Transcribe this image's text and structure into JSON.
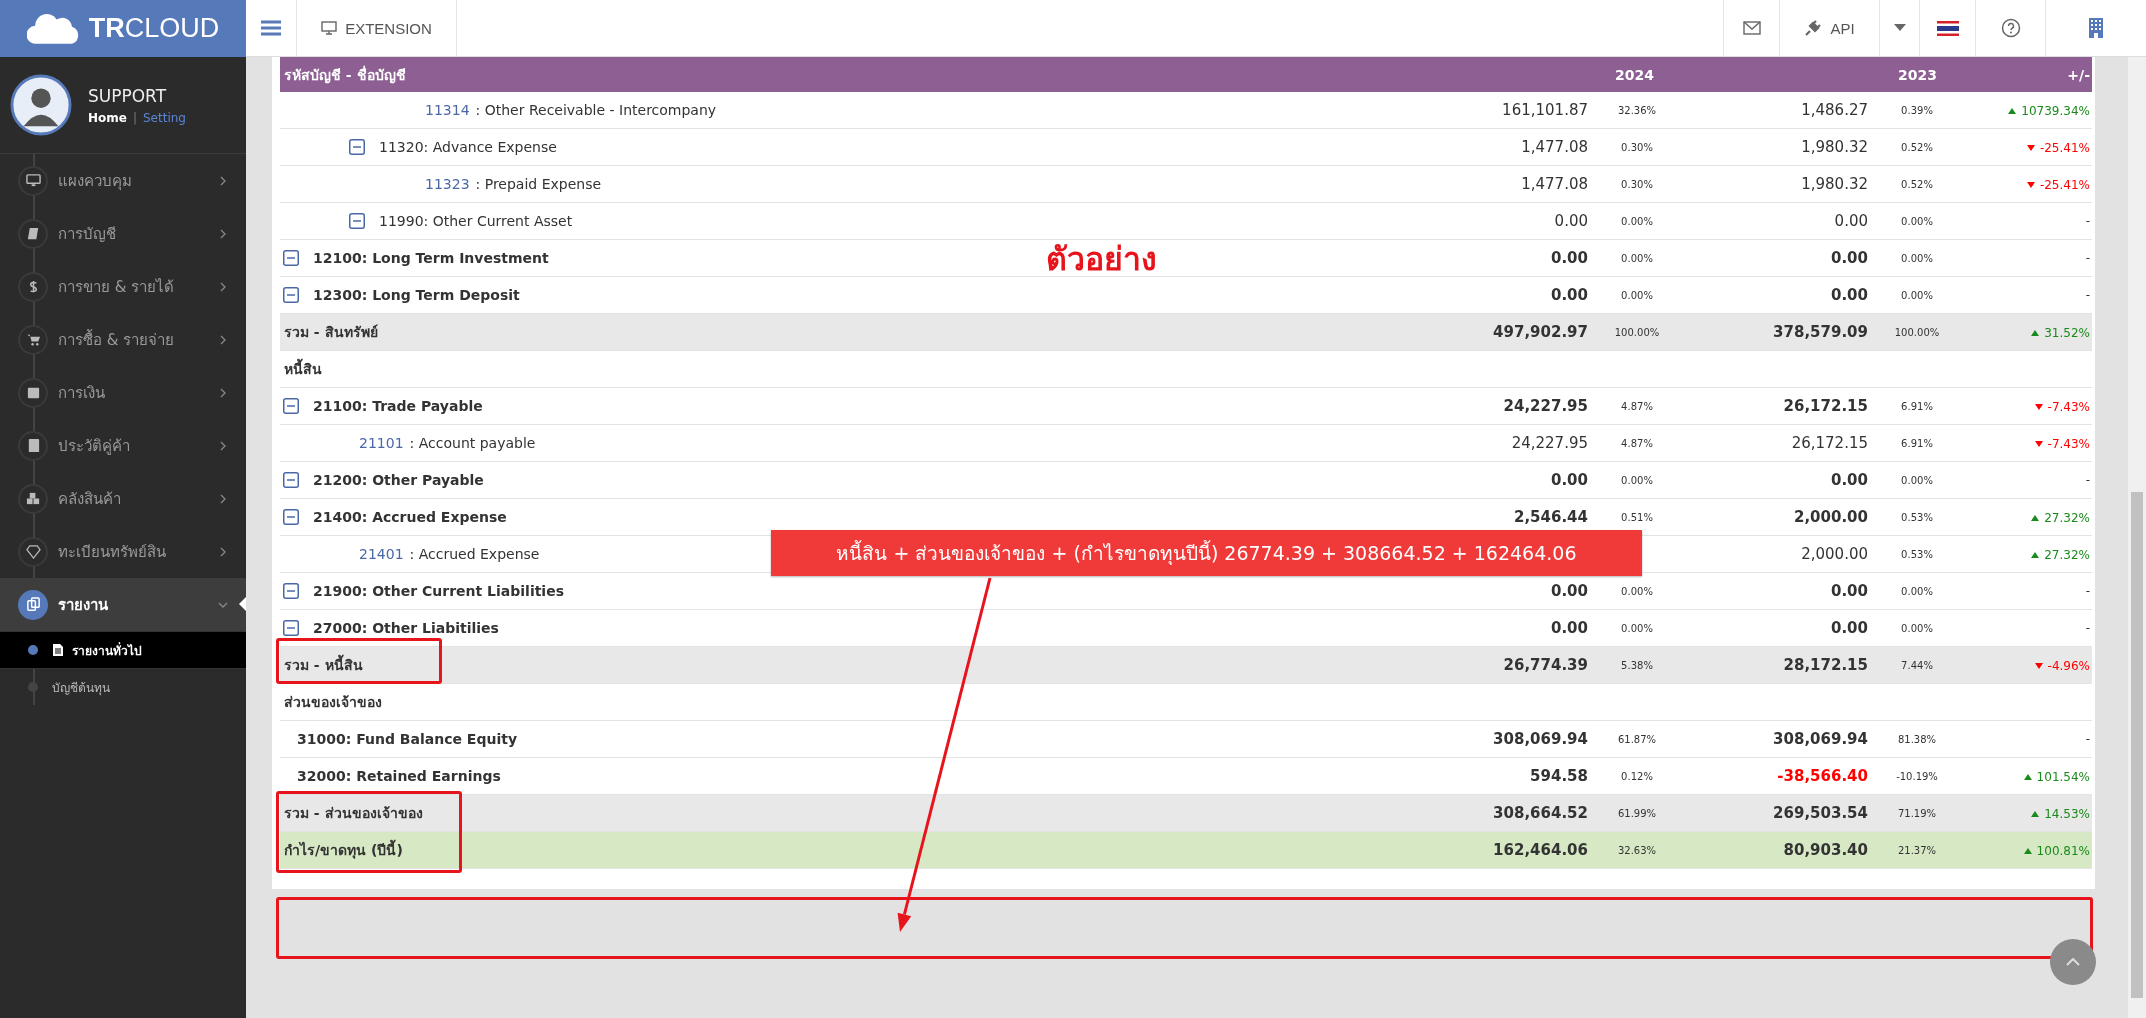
{
  "sidebar": {
    "logo": "**TR**CLOUD",
    "user": {
      "name": "SUPPORT",
      "separator": "|",
      "links": [
        {
          "label": "Home",
          "selected": true
        },
        {
          "label": "Setting",
          "selected": false
        }
      ]
    },
    "menu": [
      {
        "label": "แผงควบคุม",
        "selected": false,
        "expanded": false
      },
      {
        "label": "การบัญชี",
        "selected": false,
        "expanded": false
      },
      {
        "label": "การขาย & รายได้",
        "selected": false,
        "expanded": false
      },
      {
        "label": "การซื้อ & รายจ่าย",
        "selected": false,
        "expanded": false
      },
      {
        "label": "การเงิน",
        "selected": false,
        "expanded": false
      },
      {
        "label": "ประวัติคู่ค้า",
        "selected": false,
        "expanded": false
      },
      {
        "label": "คลังสินค้า",
        "selected": false,
        "expanded": false
      },
      {
        "label": "ทะเบียนทรัพย์สิน",
        "selected": false,
        "expanded": false
      },
      {
        "label": "รายงาน",
        "selected": true,
        "expanded": true,
        "children": [
          {
            "label": "รายงานทั่วไป",
            "selected": true
          },
          {
            "label": "บัญชีต้นทุน",
            "selected": false
          }
        ]
      }
    ]
  },
  "topbar": {
    "extension": "EXTENSION",
    "api": "API"
  },
  "table": {
    "columns": [
      "รหัสบัญชี - ชื่อบัญชี",
      "2024",
      "2023",
      "+/-"
    ],
    "rows": [
      {
        "kind": "continued",
        "children": [
          {
            "kind": "continued",
            "children": [
              {
                "kind": "account",
                "code": "11314",
                "separator": ":",
                "name": "Other Receivable - Intercompany",
                "a24": "161,101.87",
                "p24": "32.36%",
                "a23": "1,486.27",
                "p23": "0.39%",
                "change": "10739.34%",
                "up": true
              }
            ]
          },
          {
            "kind": "group",
            "label": "11320: Advance Expense",
            "a24": "1,477.08",
            "p24": "0.30%",
            "a23": "1,980.32",
            "p23": "0.52%",
            "change": "-25.41%",
            "up": false,
            "children": [
              {
                "kind": "account",
                "code": "11323",
                "separator": ":",
                "name": "Prepaid Expense",
                "a24": "1,477.08",
                "p24": "0.30%",
                "a23": "1,980.32",
                "p23": "0.52%",
                "change": "-25.41%",
                "up": false
              }
            ]
          },
          {
            "kind": "group",
            "label": "11990: Other Current Asset",
            "a24": "0.00",
            "p24": "0.00%",
            "a23": "0.00",
            "p23": "0.00%",
            "change": "-"
          }
        ]
      },
      {
        "kind": "group",
        "label": "12100: Long Term Investment",
        "a24": "0.00",
        "p24": "0.00%",
        "a23": "0.00",
        "p23": "0.00%",
        "change": "-"
      },
      {
        "kind": "group",
        "label": "12300: Long Term Deposit",
        "a24": "0.00",
        "p24": "0.00%",
        "a23": "0.00",
        "p23": "0.00%",
        "change": "-"
      },
      {
        "kind": "total",
        "label": "รวม - สินทรัพย์",
        "a24": "497,902.97",
        "p24": "100.00%",
        "a23": "378,579.09",
        "p23": "100.00%",
        "change": "31.52%",
        "up": true
      },
      {
        "kind": "section",
        "label": "หนี้สิน"
      },
      {
        "kind": "group",
        "label": "21100: Trade Payable",
        "a24": "24,227.95",
        "p24": "4.87%",
        "a23": "26,172.15",
        "p23": "6.91%",
        "change": "-7.43%",
        "up": false,
        "children": [
          {
            "kind": "account",
            "code": "21101",
            "separator": ":",
            "name": "Account payable",
            "a24": "24,227.95",
            "p24": "4.87%",
            "a23": "26,172.15",
            "p23": "6.91%",
            "change": "-7.43%",
            "up": false
          }
        ]
      },
      {
        "kind": "group",
        "label": "21200: Other Payable",
        "a24": "0.00",
        "p24": "0.00%",
        "a23": "0.00",
        "p23": "0.00%",
        "change": "-"
      },
      {
        "kind": "group",
        "label": "21400: Accrued Expense",
        "a24": "2,546.44",
        "p24": "0.51%",
        "a23": "2,000.00",
        "p23": "0.53%",
        "change": "27.32%",
        "up": true,
        "children": [
          {
            "kind": "account",
            "code": "21401",
            "separator": ":",
            "name": "Accrued Expense",
            "a23": "2,000.00",
            "p23": "0.53%",
            "change": "27.32%",
            "up": true
          }
        ]
      },
      {
        "kind": "group",
        "label": "21900: Other Current Liabilities",
        "a24": "0.00",
        "p24": "0.00%",
        "a23": "0.00",
        "p23": "0.00%",
        "change": "-"
      },
      {
        "kind": "group",
        "label": "27000: Other Liabitilies",
        "a24": "0.00",
        "p24": "0.00%",
        "a23": "0.00",
        "p23": "0.00%",
        "change": "-"
      },
      {
        "kind": "total",
        "label": "รวม - หนี้สิน",
        "a24": "26,774.39",
        "p24": "5.38%",
        "a23": "28,172.15",
        "p23": "7.44%",
        "change": "-4.96%",
        "up": false
      },
      {
        "kind": "section",
        "label": "ส่วนของเจ้าของ"
      },
      {
        "kind": "plain",
        "label": "31000: Fund Balance Equity",
        "a24": "308,069.94",
        "p24": "61.87%",
        "a23": "308,069.94",
        "p23": "81.38%",
        "change": "-"
      },
      {
        "kind": "plain",
        "label": "32000: Retained Earnings",
        "a24": "594.58",
        "p24": "0.12%",
        "a23": "-38,566.40",
        "negative_a23": true,
        "p23": "-10.19%",
        "change": "101.54%",
        "up": true
      },
      {
        "kind": "total",
        "label": "รวม - ส่วนของเจ้าของ",
        "a24": "308,664.52",
        "p24": "61.99%",
        "a23": "269,503.54",
        "p23": "71.19%",
        "change": "14.53%",
        "up": true
      },
      {
        "kind": "profit",
        "label": "กำไร/ขาดทุน (ปีนี้)",
        "a24": "162,464.06",
        "p24": "32.63%",
        "a23": "80,903.40",
        "p23": "21.37%",
        "change": "100.81%",
        "up": true
      }
    ]
  },
  "annotation": {
    "sample_label": "ตัวอย่าง",
    "callout": "หนี้สิน + ส่วนของเจ้าของ + (กำไรขาดทุนปีนี้) 26774.39 + 308664.52 + 162464.06"
  }
}
